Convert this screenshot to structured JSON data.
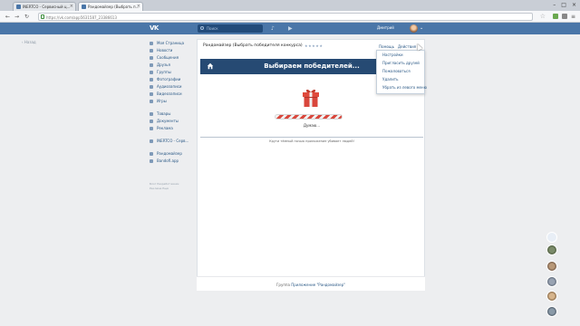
{
  "browser": {
    "tabs": [
      {
        "label": "INERTCO - Сервисный ц..."
      },
      {
        "label": "Рандомайзер (Выбрать п..."
      }
    ],
    "url": "https://vk.com/app5631587_23386613"
  },
  "vk": {
    "logo": "VK",
    "search_placeholder": "Поиск",
    "user_name": "Дмитрий"
  },
  "back_label": "Назад",
  "menu": [
    {
      "label": "Моя Страница"
    },
    {
      "label": "Новости"
    },
    {
      "label": "Сообщения"
    },
    {
      "label": "Друзья"
    },
    {
      "label": "Группы"
    },
    {
      "label": "Фотографии"
    },
    {
      "label": "Аудиозаписи"
    },
    {
      "label": "Видеозаписи"
    },
    {
      "label": "Игры"
    },
    {
      "label": "Товары"
    },
    {
      "label": "Документы"
    },
    {
      "label": "Реклама"
    },
    {
      "label": "INERTCO - Серв..."
    },
    {
      "label": "Рандомайзер"
    },
    {
      "label": "Bandofi.app"
    }
  ],
  "menu_footer": {
    "line1": "Блог  Разработчикам",
    "line2": "Реклама  Ещё"
  },
  "app": {
    "title": "Рандомайзер (Выбрать победителя конкурса)",
    "rating": "★★★★★",
    "help": "Помощь",
    "actions": "Действия",
    "banner_title": "Выбираем победителей...",
    "thinking": "Думаю...",
    "note": "Крути тёмный ночью приложение убивает людей!",
    "footer_prefix": "Группа",
    "footer_link": "Приложение \"Рандомайзер\""
  },
  "dropdown": [
    {
      "label": "Настройки"
    },
    {
      "label": "Пригласить друзей"
    },
    {
      "label": "Пожаловаться"
    },
    {
      "label": "Удалить"
    },
    {
      "label": "Убрать из левого меню"
    }
  ],
  "colors": {
    "vk_blue": "#4a76a8",
    "banner": "#264a73",
    "gift_red": "#d9473c",
    "link": "#2a5885"
  }
}
